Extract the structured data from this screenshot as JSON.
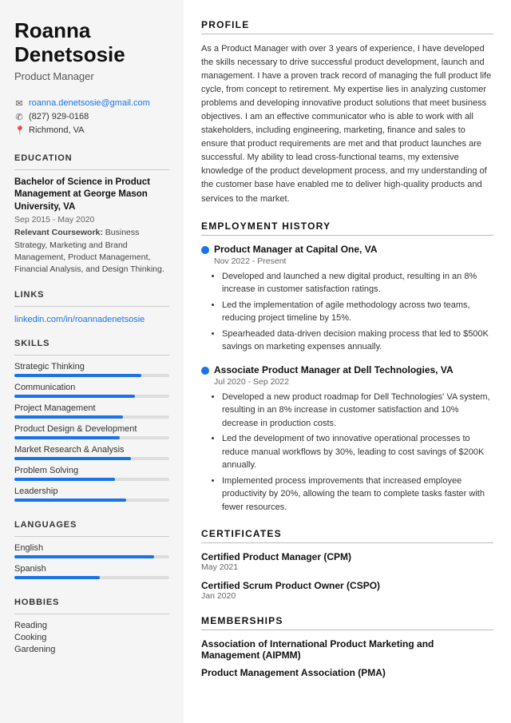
{
  "sidebar": {
    "name_line1": "Roanna",
    "name_line2": "Denetsosie",
    "title": "Product Manager",
    "contact": {
      "email": "roanna.denetsosie@gmail.com",
      "phone": "(827) 929-0168",
      "location": "Richmond, VA"
    },
    "sections": {
      "education_title": "EDUCATION",
      "education_degree": "Bachelor of Science in Product Management at George Mason University, VA",
      "education_date": "Sep 2015 - May 2020",
      "education_coursework_label": "Relevant Coursework:",
      "education_coursework": "Business Strategy, Marketing and Brand Management, Product Management, Financial Analysis, and Design Thinking.",
      "links_title": "LINKS",
      "link_text": "linkedin.com/in/roannadenetsosie",
      "link_href": "https://linkedin.com/in/roannadenetsosie",
      "skills_title": "SKILLS",
      "skills": [
        {
          "label": "Strategic Thinking",
          "pct": 82
        },
        {
          "label": "Communication",
          "pct": 78
        },
        {
          "label": "Project Management",
          "pct": 70
        },
        {
          "label": "Product Design & Development",
          "pct": 68
        },
        {
          "label": "Market Research & Analysis",
          "pct": 75
        },
        {
          "label": "Problem Solving",
          "pct": 65
        },
        {
          "label": "Leadership",
          "pct": 72
        }
      ],
      "languages_title": "LANGUAGES",
      "languages": [
        {
          "label": "English",
          "pct": 90
        },
        {
          "label": "Spanish",
          "pct": 55
        }
      ],
      "hobbies_title": "HOBBIES",
      "hobbies": [
        "Reading",
        "Cooking",
        "Gardening"
      ]
    }
  },
  "main": {
    "profile_title": "PROFILE",
    "profile_text": "As a Product Manager with over 3 years of experience, I have developed the skills necessary to drive successful product development, launch and management. I have a proven track record of managing the full product life cycle, from concept to retirement. My expertise lies in analyzing customer problems and developing innovative product solutions that meet business objectives. I am an effective communicator who is able to work with all stakeholders, including engineering, marketing, finance and sales to ensure that product requirements are met and that product launches are successful. My ability to lead cross-functional teams, my extensive knowledge of the product development process, and my understanding of the customer base have enabled me to deliver high-quality products and services to the market.",
    "employment_title": "EMPLOYMENT HISTORY",
    "jobs": [
      {
        "title": "Product Manager at Capital One, VA",
        "date": "Nov 2022 - Present",
        "bullets": [
          "Developed and launched a new digital product, resulting in an 8% increase in customer satisfaction ratings.",
          "Led the implementation of agile methodology across two teams, reducing project timeline by 15%.",
          "Spearheaded data-driven decision making process that led to $500K savings on marketing expenses annually."
        ]
      },
      {
        "title": "Associate Product Manager at Dell Technologies, VA",
        "date": "Jul 2020 - Sep 2022",
        "bullets": [
          "Developed a new product roadmap for Dell Technologies' VA system, resulting in an 8% increase in customer satisfaction and 10% decrease in production costs.",
          "Led the development of two innovative operational processes to reduce manual workflows by 30%, leading to cost savings of $200K annually.",
          "Implemented process improvements that increased employee productivity by 20%, allowing the team to complete tasks faster with fewer resources."
        ]
      }
    ],
    "certificates_title": "CERTIFICATES",
    "certificates": [
      {
        "name": "Certified Product Manager (CPM)",
        "date": "May 2021"
      },
      {
        "name": "Certified Scrum Product Owner (CSPO)",
        "date": "Jan 2020"
      }
    ],
    "memberships_title": "MEMBERSHIPS",
    "memberships": [
      {
        "name": "Association of International Product Marketing and Management (AIPMM)"
      },
      {
        "name": "Product Management Association (PMA)"
      }
    ]
  }
}
